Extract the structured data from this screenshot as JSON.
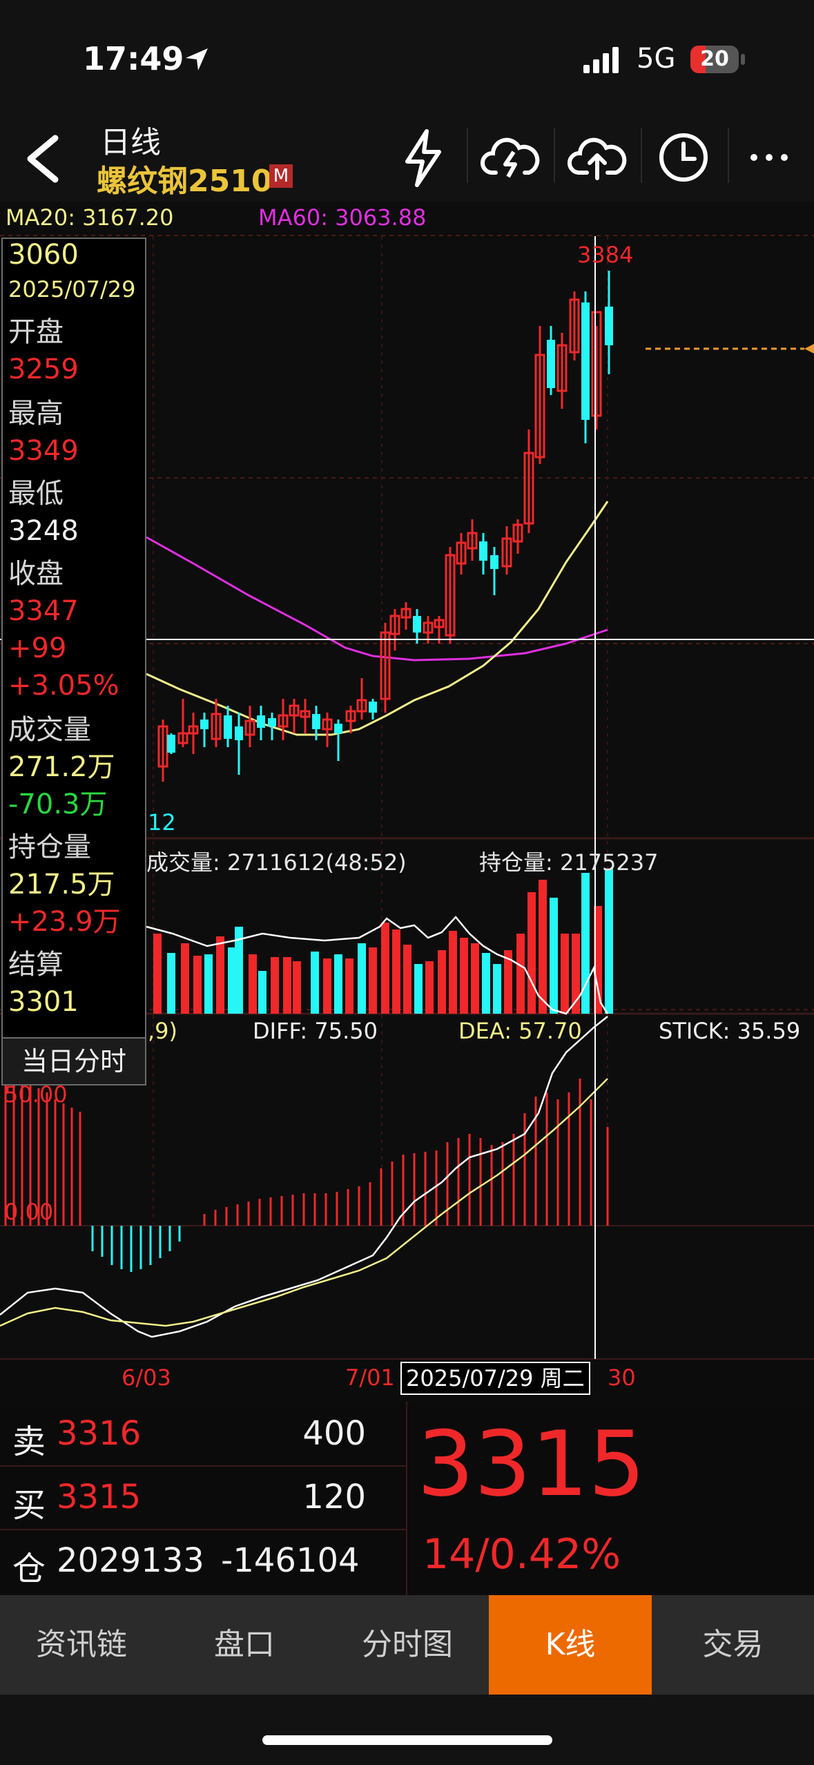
{
  "status_bar": {
    "time": "17:49",
    "network": "5G",
    "battery": "20"
  },
  "header": {
    "period": "日线",
    "contract": "螺纹钢2510",
    "market_badge": "M"
  },
  "header_icons": [
    "back-icon",
    "flash-icon",
    "cloud-sync-icon",
    "cloud-upload-icon",
    "clock-icon",
    "more-icon"
  ],
  "ma": {
    "ma20": "MA20: 3167.20",
    "ma60": "MA60: 3063.88"
  },
  "price_labels": {
    "high_marker": "3384",
    "low_marker": "12"
  },
  "info_panel": {
    "price": "3060",
    "date": "2025/07/29",
    "open_label": "开盘",
    "open": "3259",
    "high_label": "最高",
    "high": "3349",
    "low_label": "最低",
    "low": "3248",
    "close_label": "收盘",
    "close": "3347",
    "change": "+99",
    "change_pct": "+3.05%",
    "volume_label": "成交量",
    "volume": "271.2万",
    "volume_change": "-70.3万",
    "oi_label": "持仓量",
    "oi": "217.5万",
    "oi_change": "+23.9万",
    "settle_label": "结算",
    "settle": "3301",
    "intraday_button": "当日分时"
  },
  "volume_panel": {
    "volume_text": "成交量: 2711612(48:52)",
    "oi_text": "持仓量: 2175237"
  },
  "macd_panel": {
    "params": ",9)",
    "diff": "DIFF: 75.50",
    "dea": "DEA: 57.70",
    "stick": "STICK: 35.59",
    "level_top": "50.00",
    "level_zero": "0.00"
  },
  "x_axis": {
    "tick1": "6/03",
    "tick2": "7/01",
    "tick3": "30",
    "cursor_date": "2025/07/29 周二"
  },
  "quote": {
    "sell_label": "卖",
    "sell_price": "3316",
    "sell_qty": "400",
    "buy_label": "买",
    "buy_price": "3315",
    "buy_qty": "120",
    "oi_label": "仓",
    "oi_value": "2029133",
    "oi_change": "-146104",
    "last_price": "3315",
    "change": "14/0.42%"
  },
  "nav": [
    "资讯链",
    "盘口",
    "分时图",
    "K线",
    "交易"
  ],
  "colors": {
    "up": "#f0282a",
    "down": "#26f6f6",
    "accent": "#ec6a00",
    "ma20": "#f3f08a",
    "ma60": "#e02fe0"
  }
}
